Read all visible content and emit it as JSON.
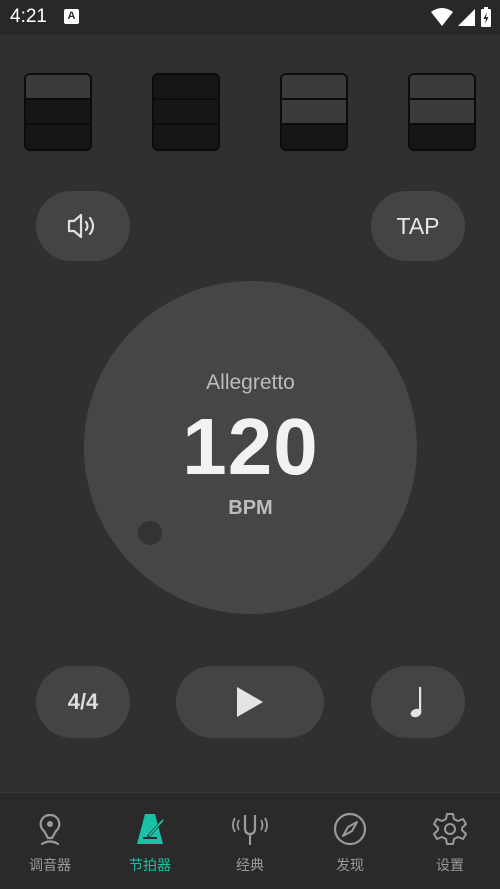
{
  "status_bar": {
    "time": "4:21",
    "app_badge": "A"
  },
  "beats": [
    {
      "accent_level": 1
    },
    {
      "accent_level": 0
    },
    {
      "accent_level": 2
    },
    {
      "accent_level": 2
    }
  ],
  "controls": {
    "tap_label": "TAP",
    "time_signature": "4/4"
  },
  "tempo": {
    "name": "Allegretto",
    "bpm": "120",
    "unit": "BPM"
  },
  "bottom_nav": {
    "items": [
      {
        "label": "调音器",
        "icon": "tuner-pin-icon"
      },
      {
        "label": "节拍器",
        "icon": "metronome-icon"
      },
      {
        "label": "经典",
        "icon": "tuning-fork-icon"
      },
      {
        "label": "发现",
        "icon": "compass-icon"
      },
      {
        "label": "设置",
        "icon": "gear-icon"
      }
    ],
    "active_index": 1
  },
  "colors": {
    "accent": "#19c2a6",
    "background": "#303030",
    "button": "#444444"
  }
}
